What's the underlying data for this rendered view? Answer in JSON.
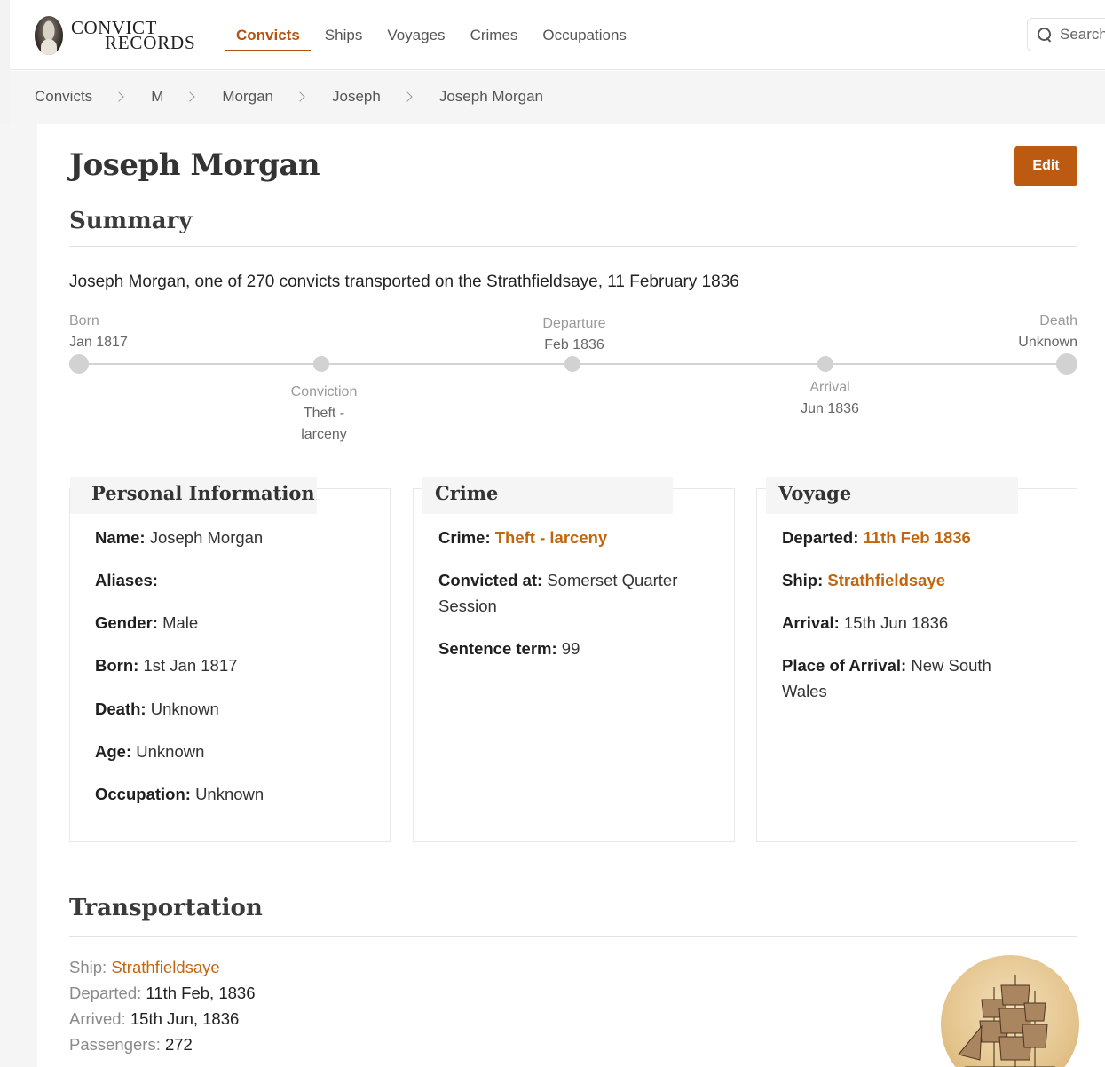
{
  "header": {
    "logo": {
      "line1": "CONVICT",
      "line2": "RECORDS"
    },
    "nav": [
      {
        "label": "Convicts",
        "active": true
      },
      {
        "label": "Ships",
        "active": false
      },
      {
        "label": "Voyages",
        "active": false
      },
      {
        "label": "Crimes",
        "active": false
      },
      {
        "label": "Occupations",
        "active": false
      }
    ],
    "search": {
      "placeholder": "Search"
    }
  },
  "breadcrumb": [
    "Convicts",
    "M",
    "Morgan",
    "Joseph",
    "Joseph Morgan"
  ],
  "page": {
    "title": "Joseph Morgan",
    "edit_label": "Edit",
    "summary_heading": "Summary",
    "summary_text": "Joseph Morgan, one of 270 convicts transported on the Strathfieldsaye, 11 February 1836"
  },
  "timeline": {
    "born": {
      "type": "Born",
      "value": "Jan 1817"
    },
    "conviction": {
      "type": "Conviction",
      "value_line1": "Theft -",
      "value_line2": "larceny"
    },
    "departure": {
      "type": "Departure",
      "value": "Feb 1836"
    },
    "arrival": {
      "type": "Arrival",
      "value": "Jun 1836"
    },
    "death": {
      "type": "Death",
      "value": "Unknown"
    }
  },
  "personal": {
    "title": "Personal Information",
    "name_label": "Name:",
    "name": "Joseph Morgan",
    "aliases_label": "Aliases:",
    "aliases": "",
    "gender_label": "Gender:",
    "gender": "Male",
    "born_label": "Born:",
    "born": "1st Jan 1817",
    "death_label": "Death:",
    "death": "Unknown",
    "age_label": "Age:",
    "age": "Unknown",
    "occupation_label": "Occupation:",
    "occupation": "Unknown"
  },
  "crime": {
    "title": "Crime",
    "crime_label": "Crime:",
    "crime": "Theft - larceny",
    "convicted_label": "Convicted at:",
    "convicted_line1": "Somerset Quarter",
    "convicted_line2": "Session",
    "sentence_label": "Sentence term:",
    "sentence": "99"
  },
  "voyage": {
    "title": "Voyage",
    "departed_label": "Departed:",
    "departed": "11th Feb 1836",
    "ship_label": "Ship:",
    "ship": "Strathfieldsaye",
    "arrival_label": "Arrival:",
    "arrival": "15th Jun 1836",
    "place_label": "Place of Arrival:",
    "place_line1": "New South",
    "place_line2": "Wales"
  },
  "transportation": {
    "heading": "Transportation",
    "ship_label": "Ship:",
    "ship": "Strathfieldsaye",
    "departed_label": "Departed:",
    "departed": "11th Feb, 1836",
    "arrived_label": "Arrived:",
    "arrived": "15th Jun, 1836",
    "passengers_label": "Passengers:",
    "passengers": "272"
  },
  "colors": {
    "accent": "#bd5a12",
    "link": "#c1660f"
  }
}
